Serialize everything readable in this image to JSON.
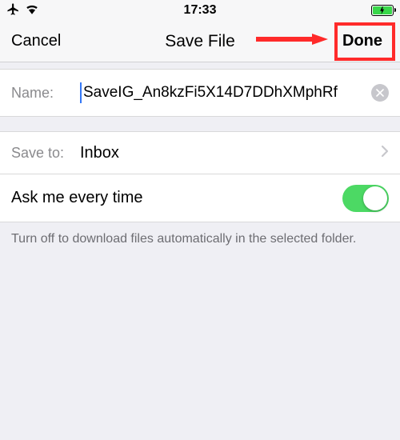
{
  "status": {
    "time": "17:33"
  },
  "nav": {
    "cancel": "Cancel",
    "title": "Save File",
    "done": "Done"
  },
  "name": {
    "label": "Name:",
    "value": "SaveIG_An8kzFi5X14D7DDhXMphRf"
  },
  "saveto": {
    "label": "Save to:",
    "value": "Inbox"
  },
  "toggle": {
    "label": "Ask me every time",
    "on": true
  },
  "footer": "Turn off to download files automatically in the selected folder."
}
